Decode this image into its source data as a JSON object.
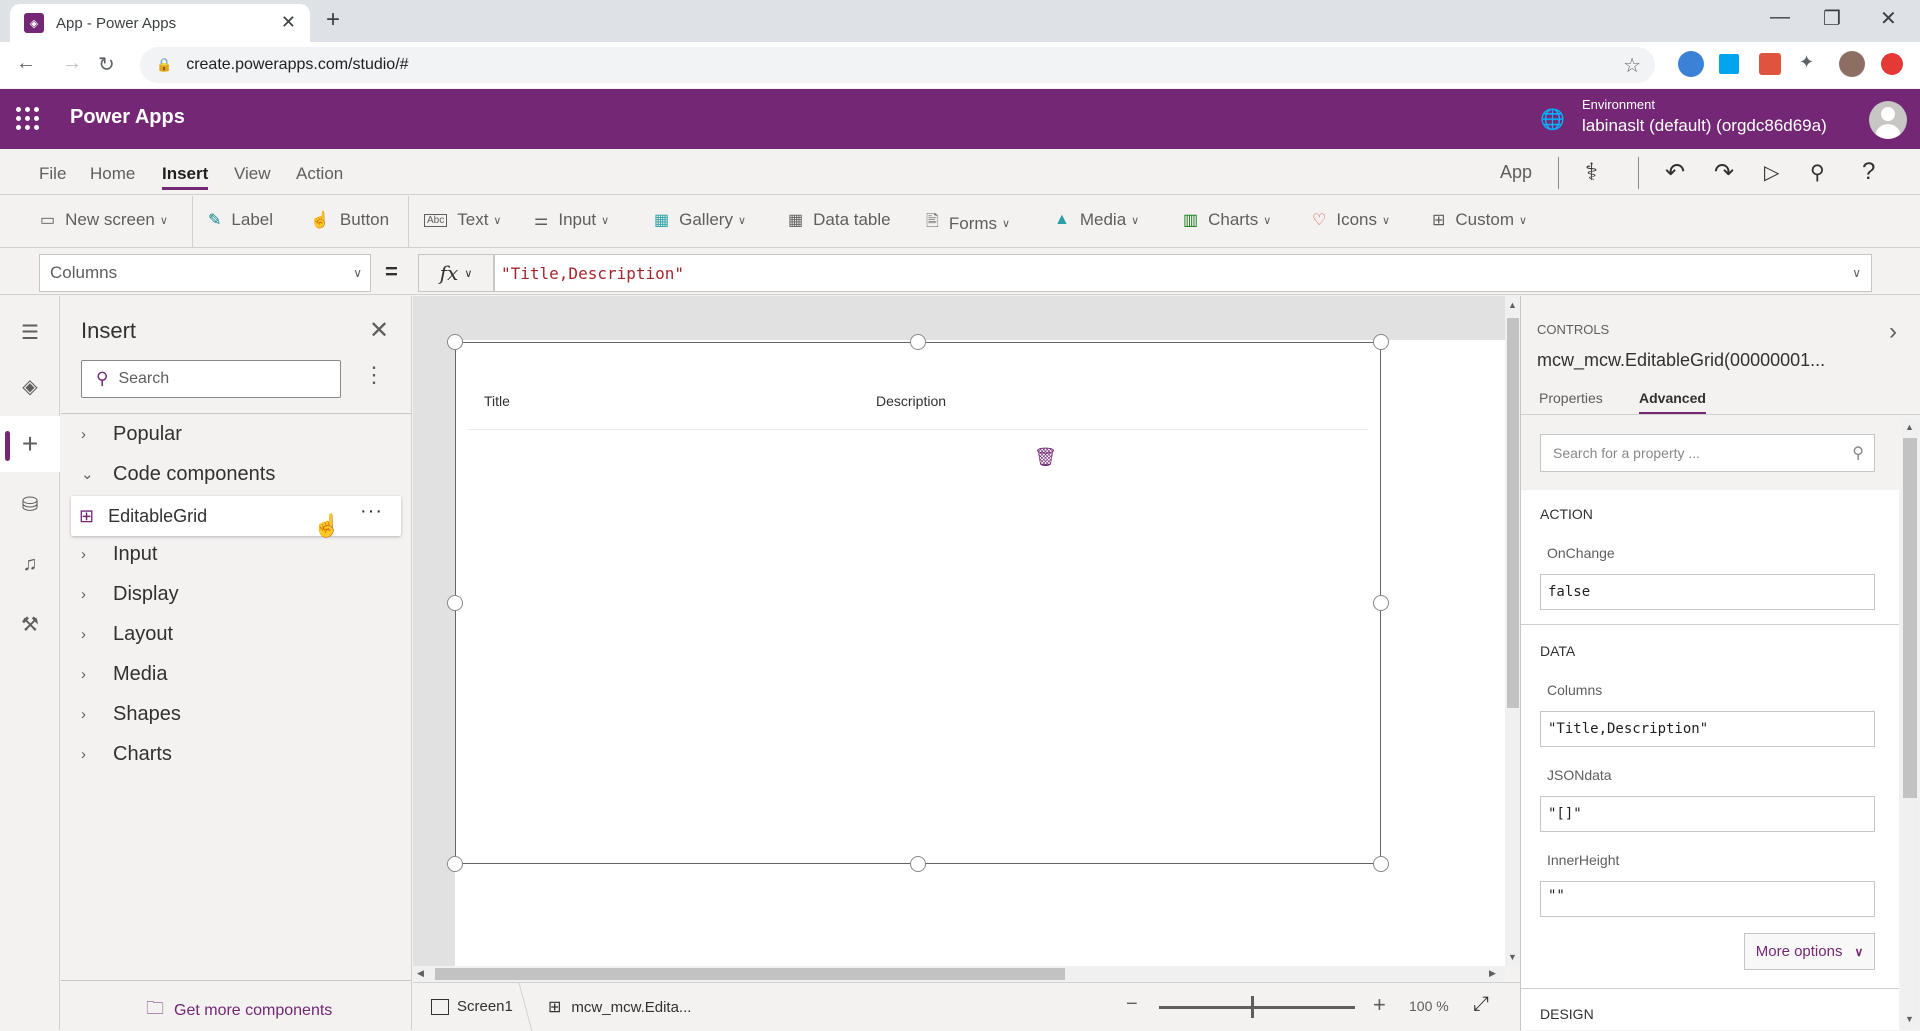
{
  "browser": {
    "tab_title": "App - Power Apps",
    "url": "create.powerapps.com/studio/#",
    "new_tab_label": "+",
    "minimize": "—",
    "restore": "❐",
    "close": "✕"
  },
  "header": {
    "brand": "Power Apps",
    "environment_label": "Environment",
    "environment_name": "labinaslt (default) (orgdc86d69a)"
  },
  "menu": {
    "tabs": [
      "File",
      "Home",
      "Insert",
      "View",
      "Action"
    ],
    "active_tab": "Insert",
    "app_label": "App"
  },
  "ribbon": {
    "items": [
      {
        "label": "New screen",
        "icon": "new-screen-icon",
        "dropdown": true
      },
      {
        "label": "Label",
        "icon": "label-icon",
        "dropdown": false
      },
      {
        "label": "Button",
        "icon": "button-icon",
        "dropdown": false
      },
      {
        "label": "Text",
        "icon": "text-icon",
        "dropdown": true
      },
      {
        "label": "Input",
        "icon": "input-icon",
        "dropdown": true
      },
      {
        "label": "Gallery",
        "icon": "gallery-icon",
        "dropdown": true
      },
      {
        "label": "Data table",
        "icon": "data-table-icon",
        "dropdown": false
      },
      {
        "label": "Forms",
        "icon": "forms-icon",
        "dropdown": true
      },
      {
        "label": "Media",
        "icon": "media-icon",
        "dropdown": true
      },
      {
        "label": "Charts",
        "icon": "charts-icon",
        "dropdown": true
      },
      {
        "label": "Icons",
        "icon": "icons-icon",
        "dropdown": true
      },
      {
        "label": "Custom",
        "icon": "custom-icon",
        "dropdown": true
      }
    ]
  },
  "formula_bar": {
    "property": "Columns",
    "equals": "=",
    "fx": "fx",
    "formula": "\"Title,Description\""
  },
  "insert_panel": {
    "title": "Insert",
    "search_placeholder": "Search",
    "categories": [
      {
        "label": "Popular",
        "expanded": false
      },
      {
        "label": "Code components",
        "expanded": true
      },
      {
        "label": "Input",
        "expanded": false
      },
      {
        "label": "Display",
        "expanded": false
      },
      {
        "label": "Layout",
        "expanded": false
      },
      {
        "label": "Media",
        "expanded": false
      },
      {
        "label": "Shapes",
        "expanded": false
      },
      {
        "label": "Charts",
        "expanded": false
      }
    ],
    "code_component_item": "EditableGrid",
    "more": "···",
    "get_more": "Get more components"
  },
  "canvas": {
    "columns": [
      "Title",
      "Description"
    ]
  },
  "status_bar": {
    "screen": "Screen1",
    "control": "mcw_mcw.Edita...",
    "zoom_value": "100 %",
    "zoom_percent": 100
  },
  "properties_panel": {
    "section_label": "CONTROLS",
    "control_name": "mcw_mcw.EditableGrid(00000001...",
    "tabs": [
      "Properties",
      "Advanced"
    ],
    "active_tab": "Advanced",
    "search_placeholder": "Search for a property ...",
    "sections": [
      {
        "title": "ACTION",
        "props": [
          {
            "name": "OnChange",
            "value": "false"
          }
        ]
      },
      {
        "title": "DATA",
        "props": [
          {
            "name": "Columns",
            "value": "\"Title,Description\""
          },
          {
            "name": "JSONdata",
            "value": "\"[]\""
          },
          {
            "name": "InnerHeight",
            "value": "\"\""
          }
        ]
      },
      {
        "title": "DESIGN",
        "props": []
      }
    ],
    "more_options": "More options"
  },
  "colors": {
    "brand": "#742774",
    "formula_text": "#a4262c"
  }
}
